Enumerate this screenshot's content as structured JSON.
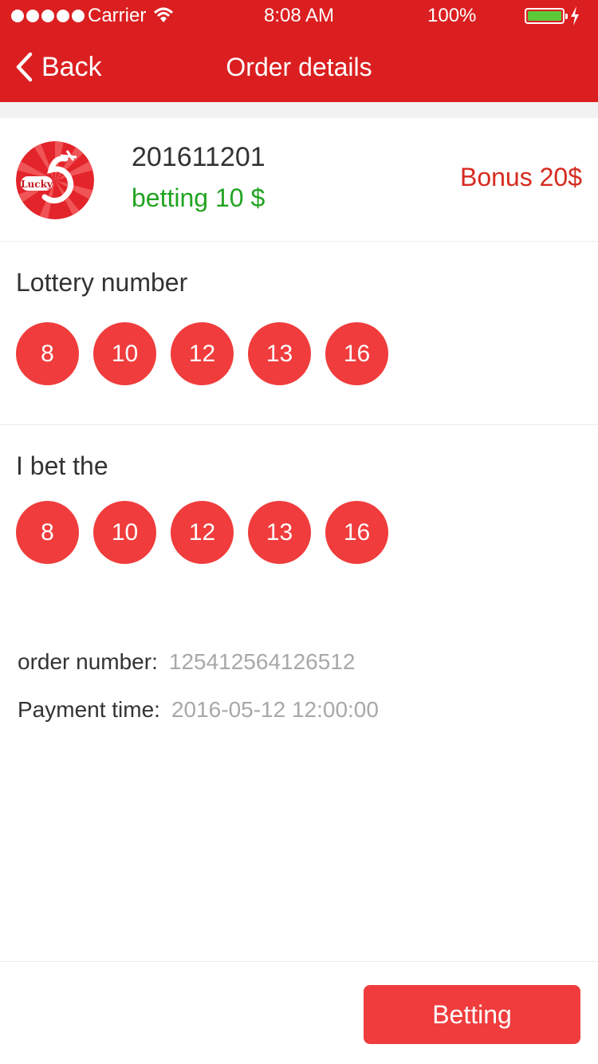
{
  "status_bar": {
    "carrier": "Carrier",
    "time": "8:08 AM",
    "battery_percent": "100%",
    "battery_level": 1.0
  },
  "nav": {
    "back_label": "Back",
    "title": "Order details"
  },
  "order": {
    "issue_number": "201611201",
    "betting": "betting 10 $",
    "bonus": "Bonus 20$"
  },
  "lottery": {
    "title": "Lottery number",
    "numbers": [
      "8",
      "10",
      "12",
      "13",
      "16"
    ]
  },
  "my_bet": {
    "title": "I bet the",
    "numbers": [
      "8",
      "10",
      "12",
      "13",
      "16"
    ]
  },
  "details": {
    "order_number_label": "order number:",
    "order_number_value": "125412564126512",
    "payment_time_label": "Payment time:",
    "payment_time_value": "2016-05-12 12:00:00"
  },
  "footer": {
    "betting_button": "Betting"
  },
  "colors": {
    "brand_red": "#db1f20",
    "ball_red": "#f03c3c",
    "betting_green": "#22a322",
    "bonus_red": "#d62a1f",
    "value_gray": "#a8a8a8"
  }
}
